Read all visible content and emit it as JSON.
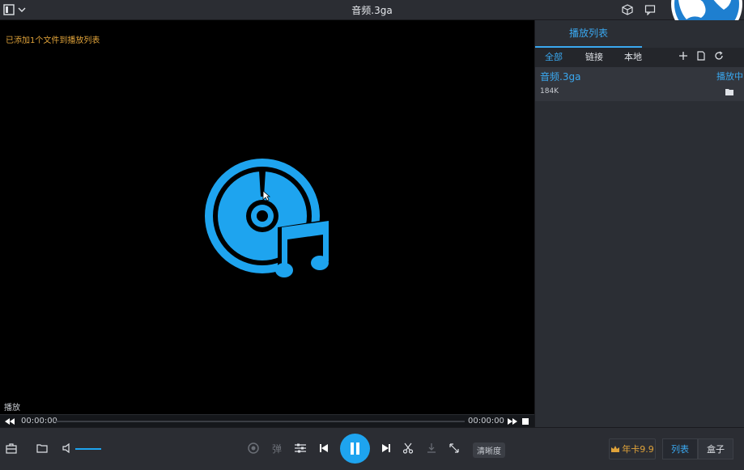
{
  "titlebar": {
    "title": "音频.3ga"
  },
  "video": {
    "notice": "已添加1个文件到播放列表",
    "status": "播放"
  },
  "seek": {
    "current": "00:00:00",
    "total": "00:00:00"
  },
  "sidebar": {
    "heading": "播放列表",
    "tabs": [
      "全部",
      "链接",
      "本地"
    ],
    "items": [
      {
        "name": "音频.3ga",
        "status": "播放中",
        "size": "184K"
      }
    ]
  },
  "controls": {
    "danmaku": "弹",
    "quality": "清晰度",
    "vip": "年卡9.9",
    "list": "列表",
    "box": "盒子"
  },
  "colors": {
    "accent": "#1ea4ef",
    "notice": "#e0a33a"
  }
}
